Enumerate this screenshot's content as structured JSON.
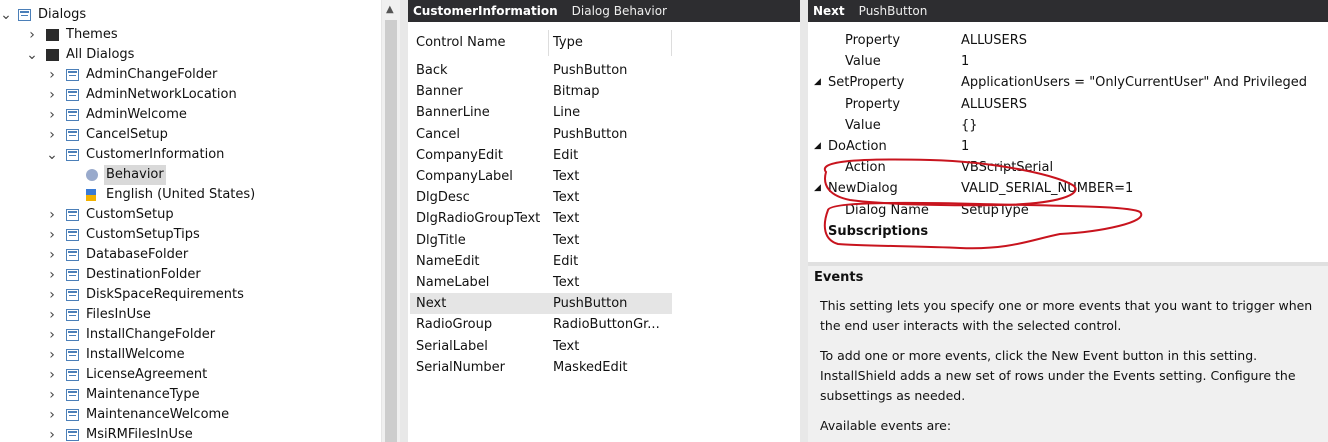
{
  "tree": {
    "root": "Dialogs",
    "themes": "Themes",
    "all_dialogs": "All Dialogs",
    "items_before": [
      "AdminChangeFolder",
      "AdminNetworkLocation",
      "AdminWelcome",
      "CancelSetup"
    ],
    "expanded": "CustomerInformation",
    "children": [
      "Behavior",
      "English (United States)"
    ],
    "items_after": [
      "CustomSetup",
      "CustomSetupTips",
      "DatabaseFolder",
      "DestinationFolder",
      "DiskSpaceRequirements",
      "FilesInUse",
      "InstallChangeFolder",
      "InstallWelcome",
      "LicenseAgreement",
      "MaintenanceType",
      "MaintenanceWelcome",
      "MsiRMFilesInUse"
    ]
  },
  "middle": {
    "title": "CustomerInformation",
    "subtitle": "Dialog Behavior",
    "col_name": "Control Name",
    "col_type": "Type",
    "rows": [
      [
        "Back",
        "PushButton"
      ],
      [
        "Banner",
        "Bitmap"
      ],
      [
        "BannerLine",
        "Line"
      ],
      [
        "Cancel",
        "PushButton"
      ],
      [
        "CompanyEdit",
        "Edit"
      ],
      [
        "CompanyLabel",
        "Text"
      ],
      [
        "DlgDesc",
        "Text"
      ],
      [
        "DlgRadioGroupText",
        "Text"
      ],
      [
        "DlgTitle",
        "Text"
      ],
      [
        "NameEdit",
        "Edit"
      ],
      [
        "NameLabel",
        "Text"
      ],
      [
        "Next",
        "PushButton"
      ],
      [
        "RadioGroup",
        "RadioButtonGr..."
      ],
      [
        "SerialLabel",
        "Text"
      ],
      [
        "SerialNumber",
        "MaskedEdit"
      ]
    ],
    "selected_index": 11
  },
  "right": {
    "title": "Next",
    "subtitle": "PushButton",
    "props": [
      {
        "name": "Property",
        "value": "ALLUSERS",
        "indent": 1,
        "tri": ""
      },
      {
        "name": "Value",
        "value": "1",
        "indent": 1,
        "tri": ""
      },
      {
        "name": "SetProperty",
        "value": "ApplicationUsers = \"OnlyCurrentUser\" And Privileged",
        "indent": 0,
        "tri": "◢"
      },
      {
        "name": "Property",
        "value": "ALLUSERS",
        "indent": 1,
        "tri": ""
      },
      {
        "name": "Value",
        "value": "{}",
        "indent": 1,
        "tri": ""
      },
      {
        "name": "DoAction",
        "value": "1",
        "indent": 0,
        "tri": "◢"
      },
      {
        "name": "Action",
        "value": "VBScriptSerial",
        "indent": 1,
        "tri": ""
      },
      {
        "name": "NewDialog",
        "value": "VALID_SERIAL_NUMBER=1",
        "indent": 0,
        "tri": "◢"
      },
      {
        "name": "Dialog Name",
        "value": "SetupType",
        "indent": 1,
        "tri": ""
      },
      {
        "name": "Subscriptions",
        "value": "",
        "indent": 0,
        "tri": "",
        "bold": true
      }
    ],
    "events_title": "Events",
    "events_p1": "This setting lets you specify one or more events that you want to trigger when the end user interacts with the selected control.",
    "events_p2": "To add one or more events, click the New Event button in this setting. InstallShield adds a new set of rows under the Events setting. Configure the subsettings as needed.",
    "events_p3": "Available events are:"
  },
  "colors": {
    "header_bg": "#2d2d30",
    "annotation": "#c8141e",
    "selection": "#d9d9d9"
  }
}
